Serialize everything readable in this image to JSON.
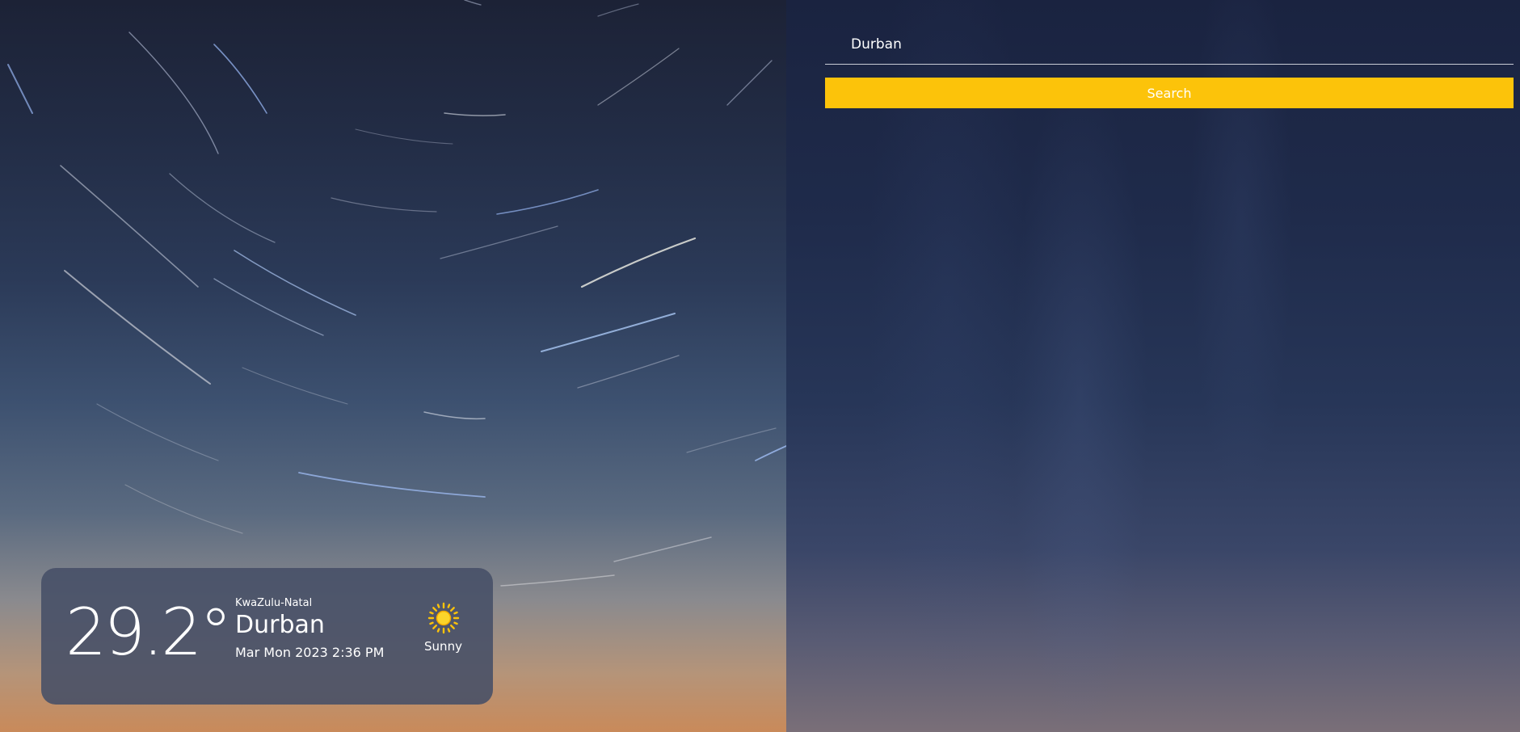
{
  "search": {
    "value": "Durban",
    "button_label": "Search"
  },
  "weather": {
    "temperature": "29.2°",
    "region": "KwaZulu-Natal",
    "city": "Durban",
    "datetime": "Mar Mon 2023 2:36 PM",
    "condition": "Sunny",
    "condition_icon": "sun-icon"
  },
  "colors": {
    "accent": "#fcc30a",
    "card_background": "#464e66",
    "text": "#ffffff"
  }
}
